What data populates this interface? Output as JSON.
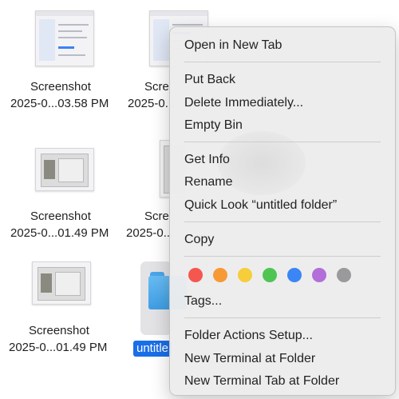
{
  "files": [
    {
      "name_line1": "Screenshot",
      "name_line2": "2025-0...03.58 PM"
    },
    {
      "name_line1": "Scre",
      "name_line2": "2025-0..."
    },
    {
      "name_line1": "Screenshot",
      "name_line2": "2025-0...01.49 PM"
    },
    {
      "name_line1": "Scre",
      "name_line2": "2025-0..."
    },
    {
      "name_line1": "Screenshot",
      "name_line2": "2025-0...01.49 PM"
    },
    {
      "name_line1": "untitle"
    }
  ],
  "menu": {
    "open_new_tab": "Open in New Tab",
    "put_back": "Put Back",
    "delete_immediately": "Delete Immediately...",
    "empty_bin": "Empty Bin",
    "get_info": "Get Info",
    "rename": "Rename",
    "quick_look": "Quick Look “untitled folder”",
    "copy": "Copy",
    "tags": "Tags...",
    "folder_actions_setup": "Folder Actions Setup...",
    "new_terminal_at_folder": "New Terminal at Folder",
    "new_terminal_tab_at_folder": "New Terminal Tab at Folder"
  },
  "tag_colors": [
    {
      "name": "red",
      "color": "#f4574f"
    },
    {
      "name": "orange",
      "color": "#f79a36"
    },
    {
      "name": "yellow",
      "color": "#f6cd3a"
    },
    {
      "name": "green",
      "color": "#4fc554"
    },
    {
      "name": "blue",
      "color": "#3b86f4"
    },
    {
      "name": "purple",
      "color": "#b36ed9"
    },
    {
      "name": "gray",
      "color": "#9a9a9d"
    }
  ]
}
